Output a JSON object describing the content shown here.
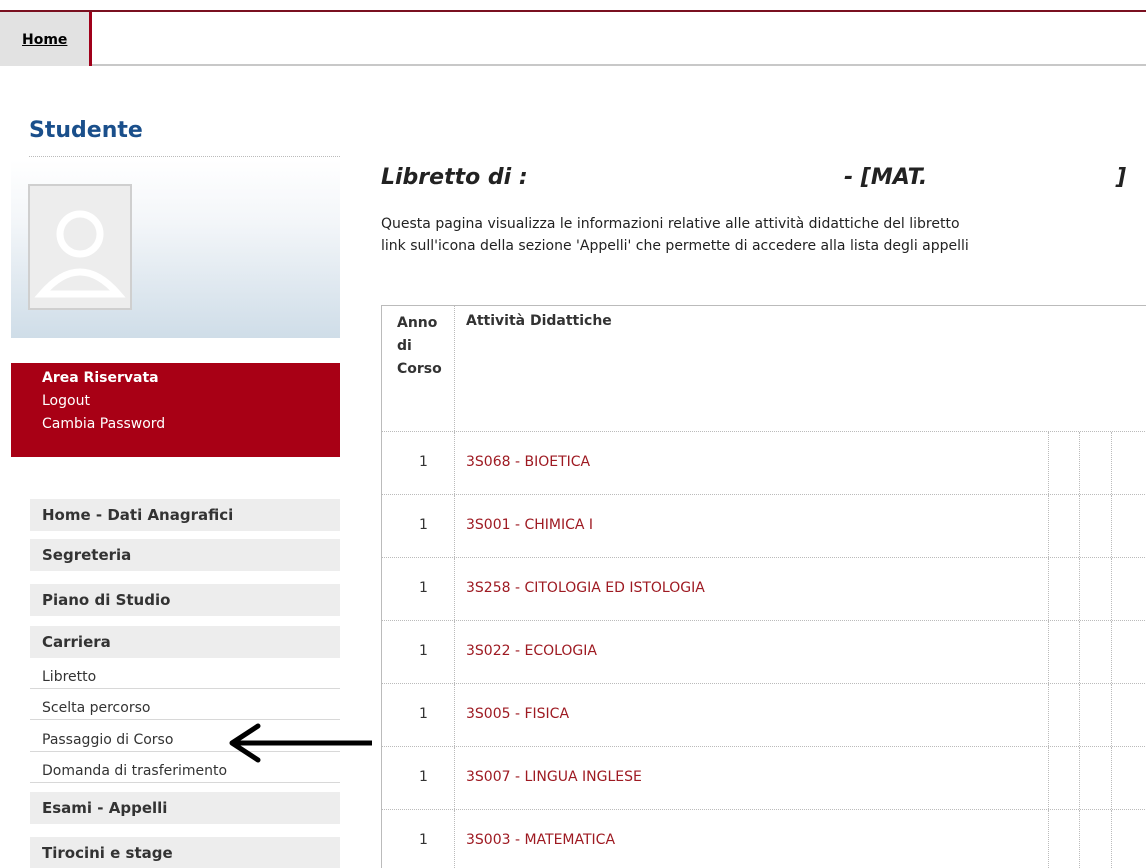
{
  "nav": {
    "home_label": "Home"
  },
  "sidebar": {
    "title": "Studente",
    "area": {
      "title": "Area Riservata",
      "logout": "Logout",
      "change_password": "Cambia Password"
    },
    "menu": [
      {
        "label": "Home - Dati Anagrafici"
      },
      {
        "label": "Segreteria"
      },
      {
        "label": "Piano di Studio"
      },
      {
        "label": "Carriera"
      },
      {
        "label": "Esami - Appelli"
      },
      {
        "label": "Tirocini e stage"
      }
    ],
    "carriera_sub": [
      {
        "label": "Libretto"
      },
      {
        "label": "Scelta percorso"
      },
      {
        "label": "Passaggio di Corso"
      },
      {
        "label": "Domanda di trasferimento"
      }
    ]
  },
  "main": {
    "heading": "Libretto di :",
    "heading_mat": "- [MAT.",
    "heading_close": "]",
    "intro_line1": "Questa pagina visualizza le informazioni relative alle attività didattiche del libretto",
    "intro_line2": "link sull'icona della sezione 'Appelli' che permette di accedere alla lista degli appelli",
    "table": {
      "header_year": "Anno di Corso",
      "header_activity": "Attività Didattiche",
      "rows": [
        {
          "year": "1",
          "activity": "3S068 - BIOETICA"
        },
        {
          "year": "1",
          "activity": "3S001 - CHIMICA I"
        },
        {
          "year": "1",
          "activity": "3S258 - CITOLOGIA ED ISTOLOGIA"
        },
        {
          "year": "1",
          "activity": "3S022 - ECOLOGIA"
        },
        {
          "year": "1",
          "activity": "3S005 - FISICA"
        },
        {
          "year": "1",
          "activity": "3S007 - LINGUA INGLESE"
        },
        {
          "year": "1",
          "activity": "3S003 - MATEMATICA"
        }
      ]
    }
  },
  "colors": {
    "brand_red": "#a80015",
    "title_blue": "#1a4f8b",
    "link_red": "#9e1a22"
  },
  "icons": {
    "avatar": "user-silhouette-icon",
    "annotation_arrow": "left-arrow-icon"
  }
}
